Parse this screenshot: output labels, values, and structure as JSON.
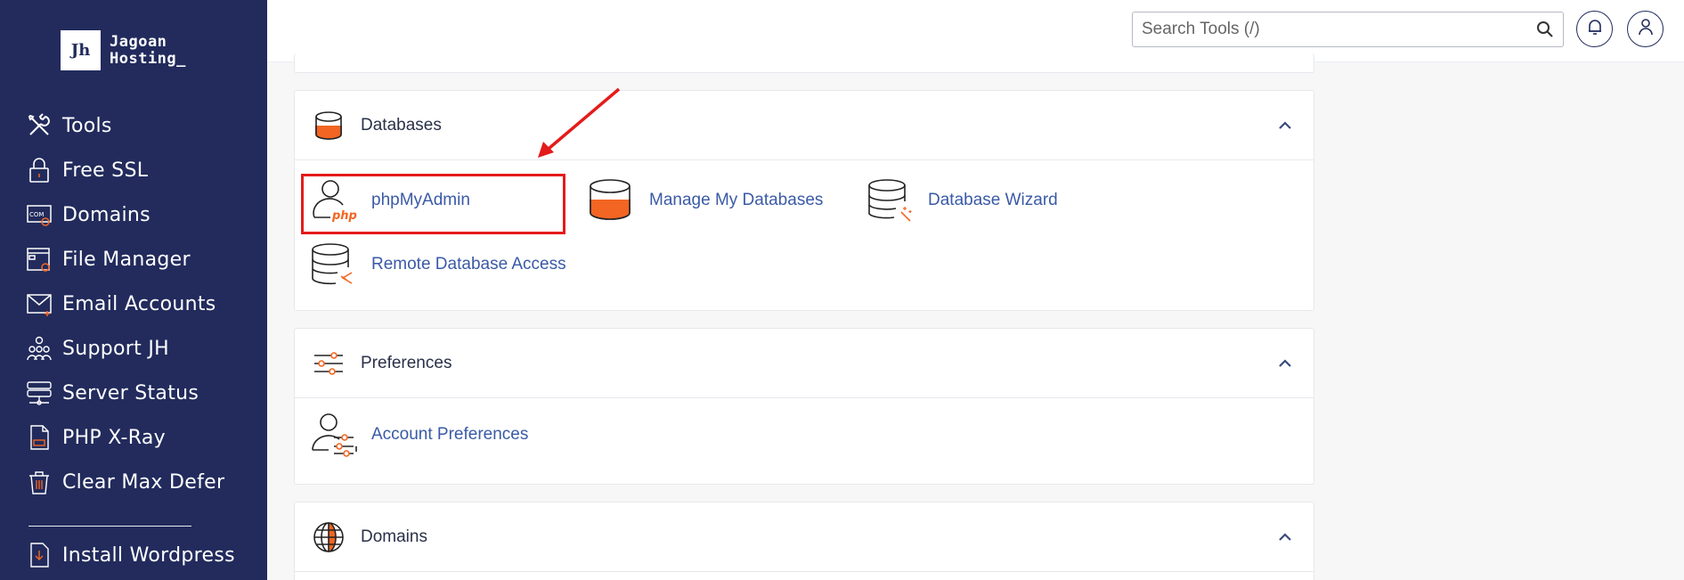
{
  "brand": {
    "logo_mark": "Jh",
    "line1": "Jagoan",
    "line2": "Hosting_"
  },
  "sidebar": {
    "items": [
      {
        "label": "Tools",
        "icon": "tools-icon"
      },
      {
        "label": "Free SSL",
        "icon": "lock-icon"
      },
      {
        "label": "Domains",
        "icon": "domain-icon"
      },
      {
        "label": "File Manager",
        "icon": "file-manager-icon"
      },
      {
        "label": "Email Accounts",
        "icon": "email-icon"
      },
      {
        "label": "Support JH",
        "icon": "support-icon"
      },
      {
        "label": "Server Status",
        "icon": "server-icon"
      },
      {
        "label": "PHP X-Ray",
        "icon": "php-file-icon"
      },
      {
        "label": "Clear Max Defer",
        "icon": "trash-icon"
      }
    ],
    "extra": {
      "label": "Install Wordpress",
      "icon": "install-icon"
    }
  },
  "header": {
    "search_placeholder": "Search Tools (/)"
  },
  "panels": {
    "databases": {
      "title": "Databases",
      "tools": [
        "phpMyAdmin",
        "Manage My Databases",
        "Database Wizard",
        "Remote Database Access"
      ],
      "php_badge": "php"
    },
    "preferences": {
      "title": "Preferences",
      "tools": [
        "Account Preferences"
      ]
    },
    "domains": {
      "title": "Domains"
    }
  },
  "colors": {
    "sidebar": "#222b5c",
    "accent": "#f26522",
    "link": "#3a5aa6",
    "highlight": "#e41b1b"
  }
}
